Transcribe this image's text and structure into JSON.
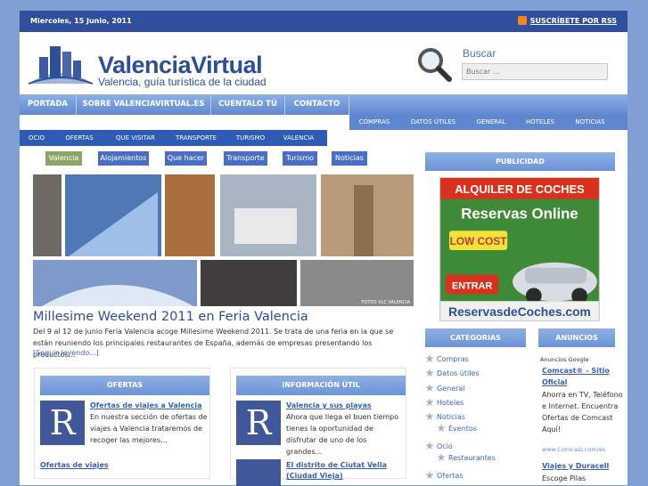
{
  "topbar": {
    "date": "Miercoles, 15 Junio, 2011",
    "rss_label": "SUSCRÍBETE POR RSS"
  },
  "header": {
    "title": "ValenciaVirtual",
    "subtitle": "Valencia, guía turística de la ciudad",
    "search_label": "Buscar",
    "search_placeholder": "Buscar ..."
  },
  "mainnav": [
    "PORTADA",
    "SOBRE VALENCIAVIRTUAL.ES",
    "CUENTALO TÚ",
    "CONTACTO"
  ],
  "subnav_right": [
    "COMPRAS",
    "DATOS ÚTILES",
    "GENERAL",
    "HOTELES",
    "NOTICIAS"
  ],
  "catnav": [
    "OCIO",
    "OFERTAS",
    "QUE VISITAR",
    "TRANSPORTE",
    "TURISMO",
    "VALENCIA"
  ],
  "tags": [
    "Valencia",
    "Alojamientos",
    "Que hacer",
    "Transporte",
    "Turismo",
    "Noticias"
  ],
  "photos": {
    "caption": "FOTOS VLC VALENCIA"
  },
  "article": {
    "title": "Millesime Weekend 2011 en Feria Valencia",
    "text": "Del 9 al 12 de junio Feria Valencia acoge Millesime Weekend 2011. Se trata de una feria en la que se están reuniendo los principales restaurantes de España, además de empresas presentando los productos...",
    "readmore": "[Seguir leyendo...]"
  },
  "box_ofertas": {
    "head": "OFERTAS",
    "item_title": "Ofertas de viajes a Valencia",
    "item_text": "En nuestra sección de ofertas de viajes a Valencia trataremos de recoger las mejores...",
    "footer": "Ofertas de viajes",
    "letter": "R"
  },
  "box_info": {
    "head": "INFORMACIÓN ÚTIL",
    "item1_title": "Valencia y sus playas",
    "item1_text": "Ahora que llega el buen tiempo tienes la oportunidad de disfrutar de uno de los grandes...",
    "item2_title": "El distrito de Ciutat Vella (Ciudad Vieja)",
    "letter": "R"
  },
  "sidebar": {
    "pub_head": "PUBLICIDAD",
    "ad": {
      "line1": "ALQUILER DE COCHES",
      "line2": "Reservas Online",
      "line3": "LOW COST",
      "button": "ENTRAR",
      "site": "ReservasdeCoches.com"
    },
    "cat_head": "CATEGORIAS",
    "categories": [
      "Compras",
      "Datos útiles",
      "General",
      "Hoteles",
      "Noticias",
      "Eventos",
      "Ocio",
      "Restaurantes",
      "Ofertas"
    ],
    "anun_head": "ANUNCIOS",
    "anuncios": {
      "google": "Anuncios Google",
      "ad1_title": "Comcast® - Sitio Oficial",
      "ad1_text": "Ahorra en TV, Teléfono e Internet. Encuentra Ofertas de Comcast Aquí!",
      "ad1_url": "www.Comcast.com/es",
      "ad2_title": "Viajes y Duracell",
      "ad2_text": "Escoge Pilas"
    }
  },
  "colors": {
    "brand": "#2c4f96",
    "nav": "#5e87cf",
    "background": "#7f9fd3"
  }
}
